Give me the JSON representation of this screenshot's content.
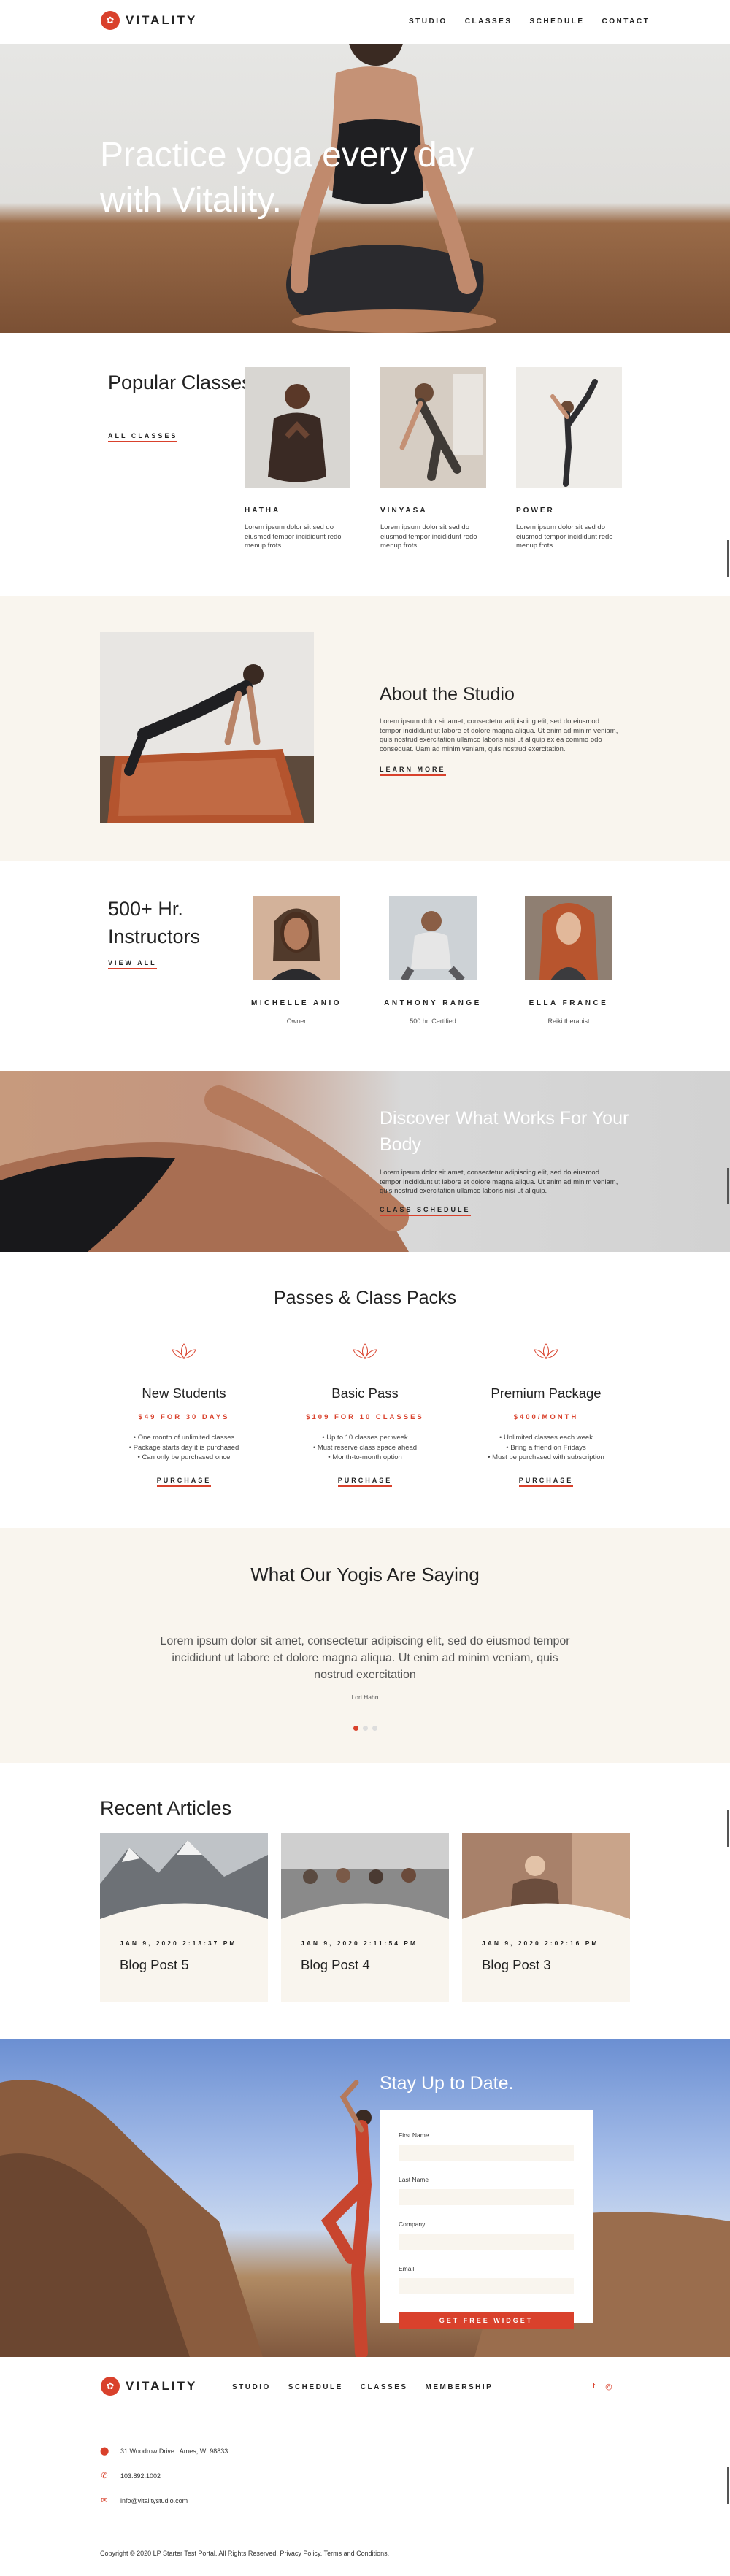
{
  "header": {
    "brand": "VITALITY",
    "nav": [
      "STUDIO",
      "CLASSES",
      "SCHEDULE",
      "CONTACT"
    ]
  },
  "hero": {
    "title": "Practice yoga every day with Vitality."
  },
  "popular": {
    "title": "Popular Classes",
    "link": "ALL CLASSES",
    "classes": [
      {
        "name": "HATHA",
        "desc": "Lorem ipsum dolor sit sed do eiusmod tempor incididunt redo menup frots."
      },
      {
        "name": "VINYASA",
        "desc": "Lorem ipsum dolor sit sed do eiusmod tempor incididunt redo menup frots."
      },
      {
        "name": "POWER",
        "desc": "Lorem ipsum dolor sit sed do eiusmod tempor incididunt redo menup frots."
      }
    ]
  },
  "about": {
    "title": "About the Studio",
    "text": "Lorem ipsum dolor sit amet, consectetur adipiscing elit, sed do eiusmod tempor incididunt ut labore et dolore magna aliqua. Ut enim ad minim veniam, quis nostrud exercitation ullamco laboris nisi ut aliquip ex ea commo odo consequat. Uam ad minim veniam, quis nostrud exercitation.",
    "link": "LEARN MORE"
  },
  "instructors": {
    "title": "500+ Hr. Instructors",
    "link": "VIEW ALL",
    "people": [
      {
        "name": "MICHELLE ANIO",
        "role": "Owner"
      },
      {
        "name": "ANTHONY RANGE",
        "role": "500 hr. Certified"
      },
      {
        "name": "ELLA FRANCE",
        "role": "Reiki therapist"
      }
    ]
  },
  "discover": {
    "title": "Discover What Works For Your Body",
    "text": "Lorem ipsum dolor sit amet, consectetur adipiscing elit, sed do eiusmod tempor incididunt ut labore et dolore magna aliqua. Ut enim ad minim veniam, quis nostrud exercitation ullamco laboris nisi ut aliquip.",
    "link": "CLASS SCHEDULE"
  },
  "passes": {
    "title": "Passes & Class Packs",
    "items": [
      {
        "name": "New Students",
        "price": "$49 FOR 30 DAYS",
        "features": [
          "One month of unlimited classes",
          "Package starts day it is purchased",
          "Can only be purchased once"
        ],
        "cta": "PURCHASE"
      },
      {
        "name": "Basic Pass",
        "price": "$109 FOR 10 CLASSES",
        "features": [
          "Up to 10 classes per week",
          "Must reserve class space ahead",
          "Month-to-month option"
        ],
        "cta": "PURCHASE"
      },
      {
        "name": "Premium Package",
        "price": "$400/MONTH",
        "features": [
          "Unlimited classes each week",
          "Bring a friend on Fridays",
          "Must be purchased with subscription"
        ],
        "cta": "PURCHASE"
      }
    ]
  },
  "testimonials": {
    "title": "What Our Yogis Are Saying",
    "quote": "Lorem ipsum dolor sit amet, consectetur adipiscing elit, sed do eiusmod tempor incididunt ut labore et dolore magna aliqua. Ut enim ad minim veniam, quis nostrud exercitation",
    "author": "Lori Hahn",
    "active_slide": 1,
    "slide_count": 3
  },
  "articles": {
    "title": "Recent Articles",
    "posts": [
      {
        "date": "JAN 9, 2020 2:13:37 PM",
        "title": "Blog Post 5"
      },
      {
        "date": "JAN 9, 2020 2:11:54 PM",
        "title": "Blog Post 4"
      },
      {
        "date": "JAN 9, 2020 2:02:16 PM",
        "title": "Blog Post 3"
      }
    ]
  },
  "subscribe": {
    "title": "Stay Up to Date.",
    "fields": [
      "First Name",
      "Last Name",
      "Company",
      "Email"
    ],
    "button": "GET FREE WIDGET"
  },
  "footer": {
    "brand": "VITALITY",
    "nav": [
      "STUDIO",
      "SCHEDULE",
      "CLASSES",
      "MEMBERSHIP"
    ],
    "address": "31 Woodrow Drive | Ames, WI 98833",
    "phone": "103.892.1002",
    "email": "info@vitalitystudio.com",
    "copyright": "Copyright © 2020 LP Starter Test Portal. All Rights Reserved. Privacy Policy. Terms and Conditions."
  },
  "colors": {
    "accent": "#d9412c",
    "cream": "#f9f5ee"
  }
}
